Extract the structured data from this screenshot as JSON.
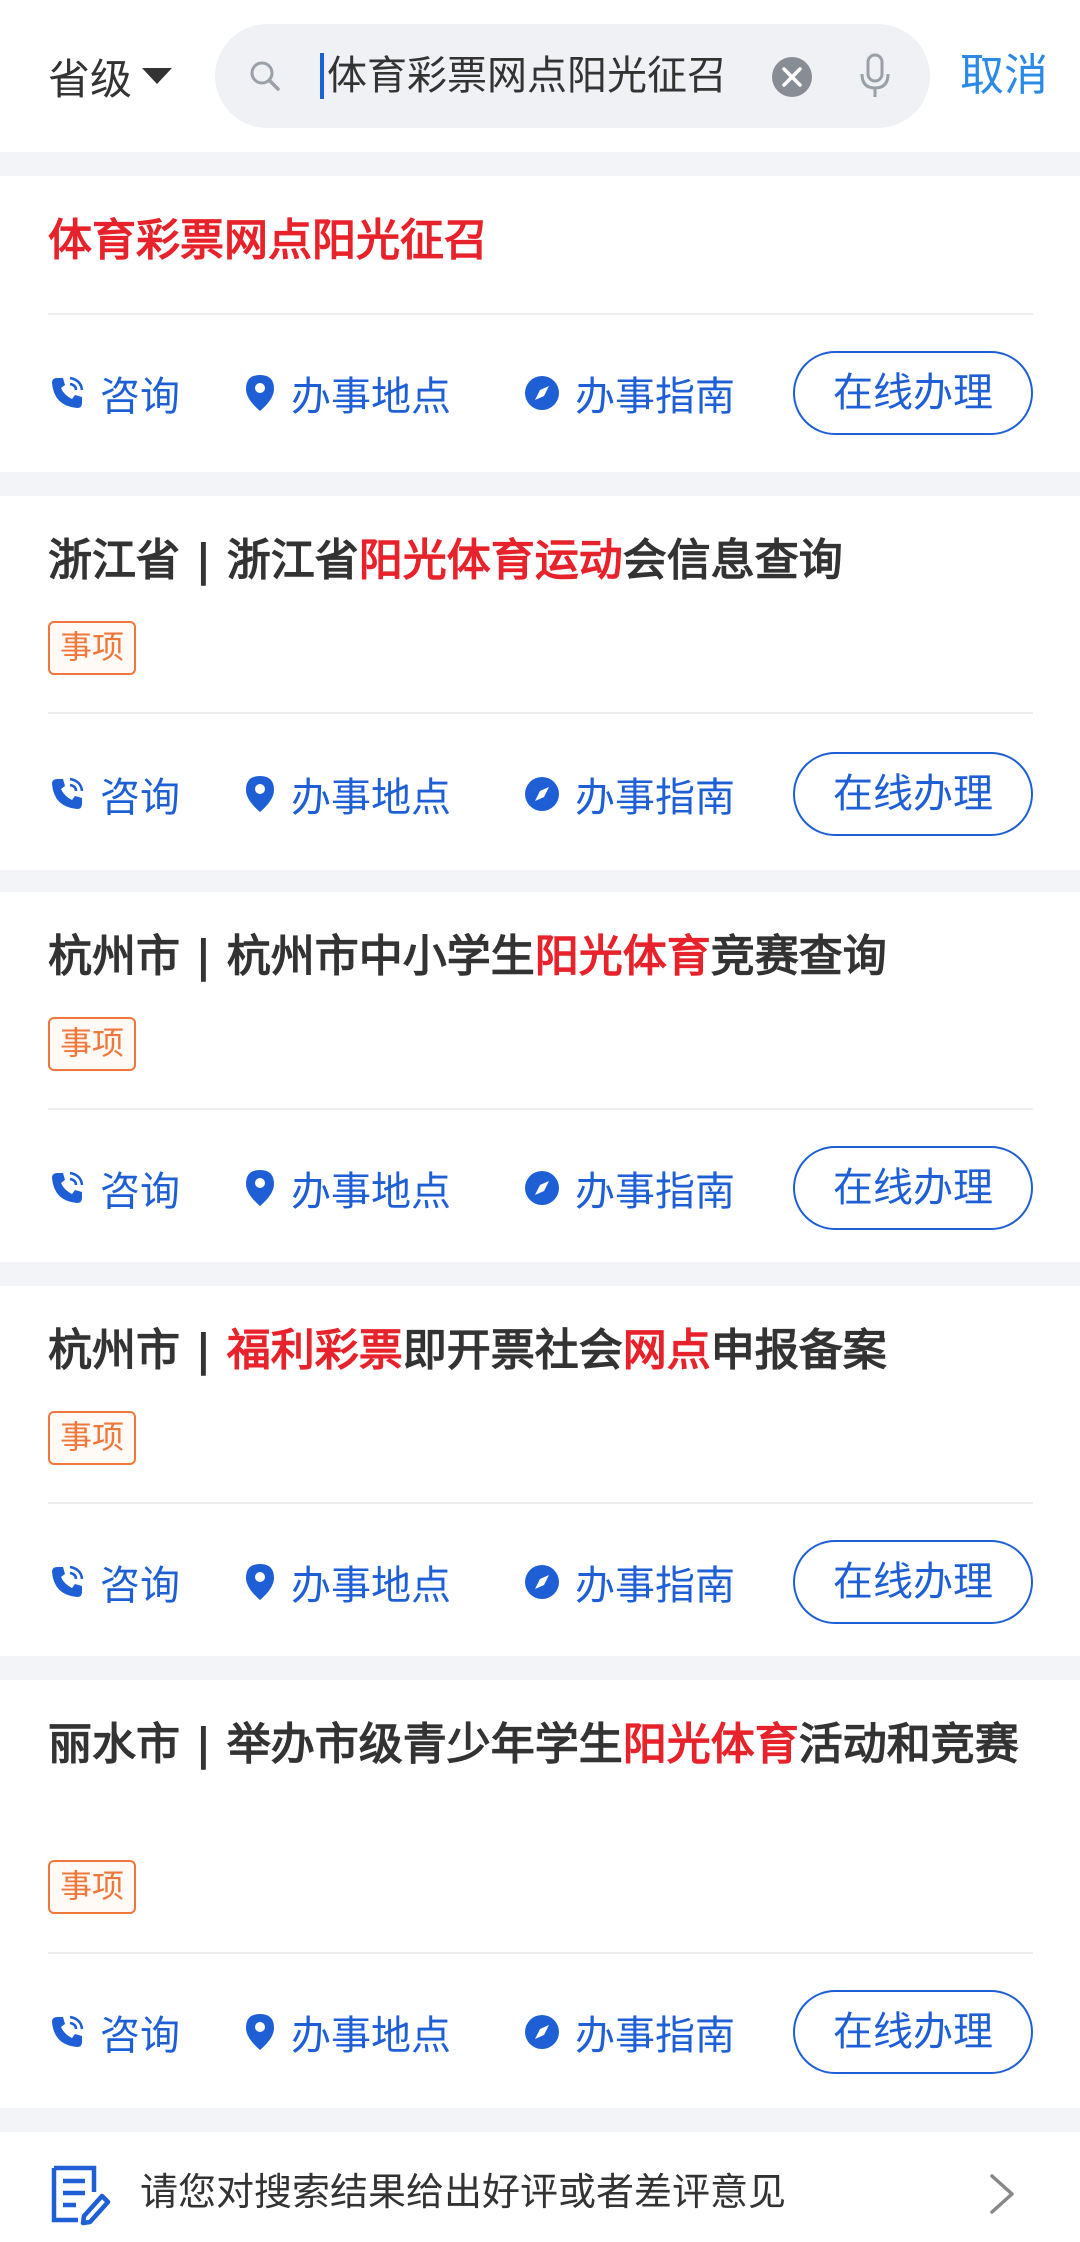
{
  "header": {
    "level_label": "省级",
    "query": "体育彩票网点阳光征召",
    "cancel_label": "取消"
  },
  "actions": {
    "consult": "咨询",
    "place": "办事地点",
    "guide": "办事指南",
    "online": "在线办理"
  },
  "results": [
    {
      "title_parts": [
        {
          "text": "体育彩票网点阳光征召",
          "highlight": true
        }
      ],
      "tag": ""
    },
    {
      "title_parts": [
        {
          "text": "浙江省 | 浙江省",
          "highlight": false
        },
        {
          "text": "阳光体育运动",
          "highlight": true
        },
        {
          "text": "会信息查询",
          "highlight": false
        }
      ],
      "tag": "事项"
    },
    {
      "title_parts": [
        {
          "text": "杭州市 | 杭州市中小学生",
          "highlight": false
        },
        {
          "text": "阳光体育",
          "highlight": true
        },
        {
          "text": "竞赛查询",
          "highlight": false
        }
      ],
      "tag": "事项"
    },
    {
      "title_parts": [
        {
          "text": "杭州市 | ",
          "highlight": false
        },
        {
          "text": "福利彩票",
          "highlight": true
        },
        {
          "text": "即开票社会",
          "highlight": false
        },
        {
          "text": "网点",
          "highlight": true
        },
        {
          "text": "申报备案",
          "highlight": false
        }
      ],
      "tag": "事项"
    },
    {
      "title_parts": [
        {
          "text": "丽水市 | 举办市级青少年学生",
          "highlight": false
        },
        {
          "text": "阳光体育",
          "highlight": true
        },
        {
          "text": "活动和竞赛",
          "highlight": false
        }
      ],
      "tag": "事项"
    }
  ],
  "feedback": {
    "text": "请您对搜索结果给出好评或者差评意见"
  },
  "colors": {
    "accent": "#1f5fd6",
    "highlight": "#e8222a",
    "tag": "#f0773a",
    "cancel": "#2b8ae6"
  }
}
